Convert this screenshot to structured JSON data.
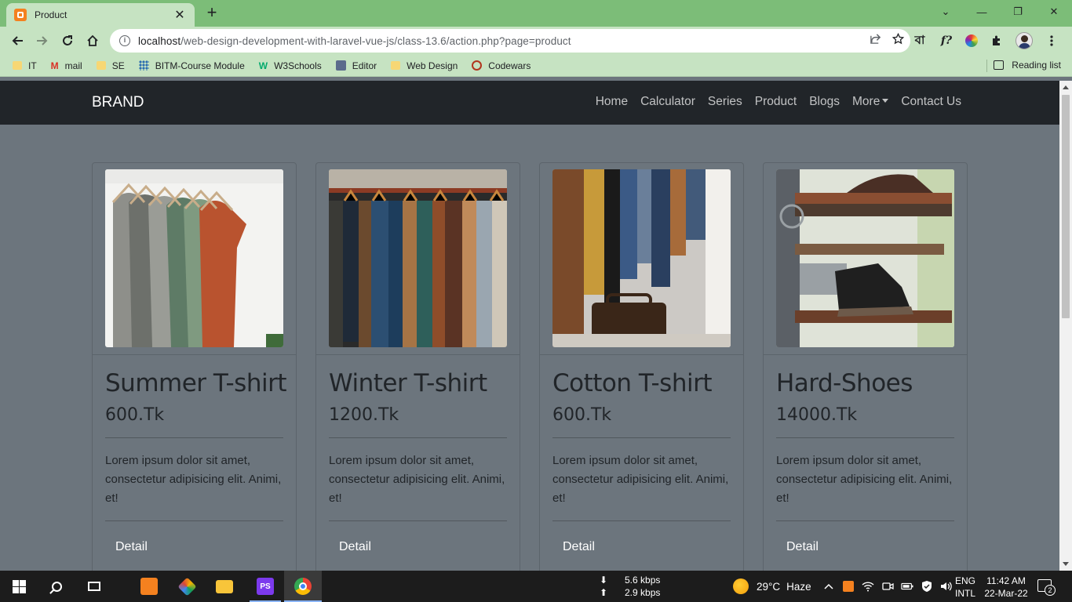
{
  "browser": {
    "tab_title": "Product",
    "tab_close": "✕",
    "new_tab": "+",
    "url_host": "localhost",
    "url_path": "/web-design-development-with-laravel-vue-js/class-13.6/action.php?page=product",
    "ext_bn": "বা",
    "ext_fx": "f?",
    "window_controls": {
      "chevron": "⌄",
      "minimize": "—",
      "restore": "❐",
      "close": "✕"
    }
  },
  "bookmarks": [
    {
      "label": "IT",
      "icon": "folder-icon"
    },
    {
      "label": "mail",
      "icon": "gmail-icon"
    },
    {
      "label": "SE",
      "icon": "folder-icon"
    },
    {
      "label": "BITM-Course Module",
      "icon": "bitm-icon"
    },
    {
      "label": "W3Schools",
      "icon": "w3schools-icon"
    },
    {
      "label": "Editor",
      "icon": "editor-icon"
    },
    {
      "label": "Web Design",
      "icon": "folder-icon"
    },
    {
      "label": "Codewars",
      "icon": "codewars-icon"
    }
  ],
  "reading_list": "Reading list",
  "navbar": {
    "brand": "BRAND",
    "links": [
      "Home",
      "Calculator",
      "Series",
      "Product",
      "Blogs",
      "More",
      "Contact Us"
    ]
  },
  "products": [
    {
      "title": "Summer T-shirt",
      "price": "600.Tk",
      "description": "Lorem ipsum dolor sit amet, consectetur adipisicing elit. Animi, et!",
      "button": "Detail"
    },
    {
      "title": "Winter T-shirt",
      "price": "1200.Tk",
      "description": "Lorem ipsum dolor sit amet, consectetur adipisicing elit. Animi, et!",
      "button": "Detail"
    },
    {
      "title": "Cotton T-shirt",
      "price": "600.Tk",
      "description": "Lorem ipsum dolor sit amet, consectetur adipisicing elit. Animi, et!",
      "button": "Detail"
    },
    {
      "title": "Hard-Shoes",
      "price": "14000.Tk",
      "description": "Lorem ipsum dolor sit amet, consectetur adipisicing elit. Animi, et!",
      "button": "Detail"
    }
  ],
  "taskbar": {
    "ps_label": "PS",
    "net_down": "5.6 kbps",
    "net_up": "2.9 kbps",
    "temperature": "29°C",
    "weather": "Haze",
    "lang_1": "ENG",
    "lang_2": "INTL",
    "time": "11:42 AM",
    "date": "22-Mar-22",
    "notifications": "2"
  },
  "colors": {
    "tabbar": "#7cbd78",
    "toolbar": "#c6e3c2",
    "navbar": "#212529",
    "page_bg": "#6c757d",
    "taskbar": "#1c1c1c"
  }
}
